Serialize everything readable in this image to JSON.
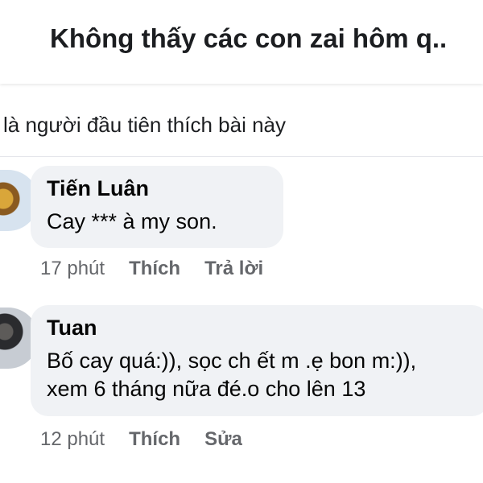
{
  "header": {
    "title": "Không thấy các con zai hôm q.."
  },
  "likes": {
    "text": "là người đầu tiên thích bài này"
  },
  "comments": [
    {
      "author": "Tiến Luân",
      "lines": [
        "Cay *** à my son."
      ],
      "time": "17 phút",
      "actions": [
        "Thích",
        "Trả lời"
      ],
      "avatar_icon": "user-avatar"
    },
    {
      "author": "Tuan",
      "lines": [
        "Bố cay quá:)), sọc ch ết m .ẹ bon m:)),",
        "xem 6 tháng nữa đé.o cho lên 13"
      ],
      "time": "12 phút",
      "actions": [
        "Thích",
        "Sửa"
      ],
      "avatar_icon": "user-avatar"
    }
  ],
  "colors": {
    "background": "#ffffff",
    "bubble": "#f0f2f5",
    "text": "#1c1e21",
    "secondary_text": "#65676b",
    "divider": "#e4e6eb"
  }
}
